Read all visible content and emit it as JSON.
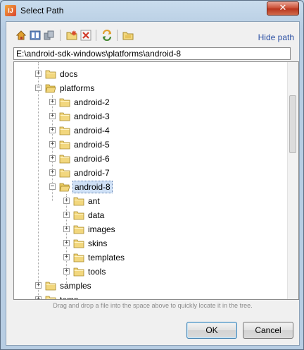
{
  "window": {
    "title": "Select Path",
    "app_icon_text": "IJ",
    "close_symbol": "✕"
  },
  "toolbar": {
    "icons": [
      "home-icon",
      "project-icon",
      "module-icon",
      "new-folder-icon",
      "delete-icon",
      "refresh-icon",
      "show-hidden-icon"
    ],
    "hide_path_label": "Hide path"
  },
  "path": {
    "value": "E:\\android-sdk-windows\\platforms\\android-8"
  },
  "tree": {
    "rows": [
      {
        "label": "docs",
        "level": 0,
        "expander": "+",
        "open": false,
        "selected": false
      },
      {
        "label": "platforms",
        "level": 0,
        "expander": "−",
        "open": true,
        "selected": false
      },
      {
        "label": "android-2",
        "level": 1,
        "expander": "+",
        "open": false,
        "selected": false
      },
      {
        "label": "android-3",
        "level": 1,
        "expander": "+",
        "open": false,
        "selected": false
      },
      {
        "label": "android-4",
        "level": 1,
        "expander": "+",
        "open": false,
        "selected": false
      },
      {
        "label": "android-5",
        "level": 1,
        "expander": "+",
        "open": false,
        "selected": false
      },
      {
        "label": "android-6",
        "level": 1,
        "expander": "+",
        "open": false,
        "selected": false
      },
      {
        "label": "android-7",
        "level": 1,
        "expander": "+",
        "open": false,
        "selected": false
      },
      {
        "label": "android-8",
        "level": 1,
        "expander": "−",
        "open": true,
        "selected": true
      },
      {
        "label": "ant",
        "level": 2,
        "expander": "+",
        "open": false,
        "selected": false
      },
      {
        "label": "data",
        "level": 2,
        "expander": "+",
        "open": false,
        "selected": false
      },
      {
        "label": "images",
        "level": 2,
        "expander": "+",
        "open": false,
        "selected": false
      },
      {
        "label": "skins",
        "level": 2,
        "expander": "+",
        "open": false,
        "selected": false
      },
      {
        "label": "templates",
        "level": 2,
        "expander": "+",
        "open": false,
        "selected": false
      },
      {
        "label": "tools",
        "level": 2,
        "expander": "+",
        "open": false,
        "selected": false
      },
      {
        "label": "samples",
        "level": 0,
        "expander": "+",
        "open": false,
        "selected": false
      },
      {
        "label": "temp",
        "level": 0,
        "expander": "+",
        "open": false,
        "selected": false
      }
    ]
  },
  "hint": "Drag and drop a file into the space above to quickly locate it in the tree.",
  "buttons": {
    "ok": "OK",
    "cancel": "Cancel"
  },
  "colors": {
    "folder": "#f2d77e",
    "selection": "#cfe0f5",
    "link": "#2a4fa3"
  }
}
